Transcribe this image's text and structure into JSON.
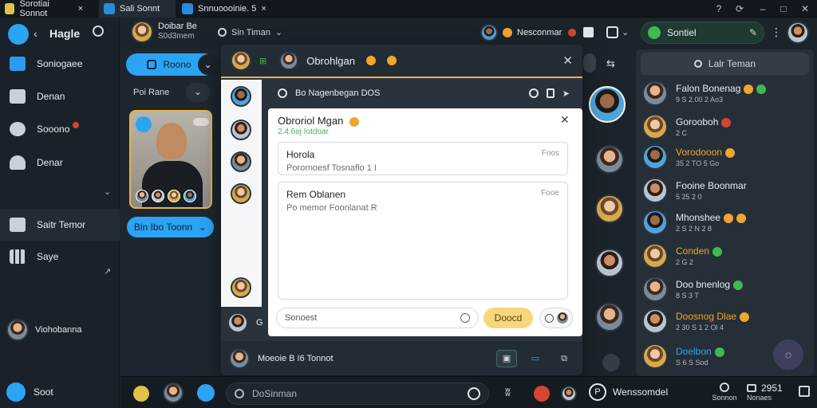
{
  "titlebar": {
    "tabs": [
      {
        "label": "Sorotiai Sonnot",
        "active": false
      },
      {
        "label": "Sali Sonnt",
        "active": true
      },
      {
        "label": "Snnuoooinie. 5",
        "active": false
      }
    ],
    "close_glyph": "×"
  },
  "sidebar": {
    "title": "Hagle",
    "items": [
      {
        "label": "Soniogaee",
        "icon": "chat-bubble-icon"
      },
      {
        "label": "Denan",
        "icon": "grid-icon"
      },
      {
        "label": "Sooono",
        "icon": "mic-icon"
      },
      {
        "label": "Denar",
        "icon": "cloud-icon"
      },
      {
        "label": "Saitr Temor",
        "icon": "folder-icon",
        "selected": true
      },
      {
        "label": "Saye",
        "icon": "apps-icon"
      }
    ],
    "profile_label": "Viohobanna",
    "footer_label": "Soot"
  },
  "header": {
    "channel_title": "Doibar Be",
    "channel_subtitle": "S0d3mem",
    "selector_label": "Sin Timan",
    "user_badge_label": "Nesconmar",
    "search_label": "Sontiel"
  },
  "col2": {
    "top_button": "Roono",
    "filter_label": "Poi Rane",
    "bottom_button": "Bin Ibo Toonn"
  },
  "dialog": {
    "title": "Obrohlgan",
    "thread_title": "Bo Nagenbegan DOS",
    "inner_title": "Obroriol Mgan",
    "inner_meta": "2.4.6oj Iotdoar",
    "messages": [
      {
        "title": "Horola",
        "sub": "Porornoesf Tosnaflo 1 I",
        "side": "Foos"
      },
      {
        "title": "Rem Oblanen",
        "sub": "Po memor Foonlanat R",
        "side": "Fooe"
      }
    ],
    "reply_placeholder": "Sonoest",
    "send_label": "Doocd",
    "row1_label": "G",
    "footer_label": "Moeoie B I6 Tonnot"
  },
  "right_panel": {
    "title": "Lalr Teman",
    "contacts": [
      {
        "name": "Falon Bonenag",
        "meta": "9 S 2.00 2 Ao3"
      },
      {
        "name": "Gorooboh",
        "meta": "2 C"
      },
      {
        "name": "Vorodooon",
        "meta": "35 2 TO 5 Go"
      },
      {
        "name": "Fooine Boonmar",
        "meta": "5 25 2 0"
      },
      {
        "name": "Mhonshee",
        "meta": "2 S 2 N 2 8"
      },
      {
        "name": "Conden",
        "meta": "2 G 2"
      },
      {
        "name": "Doo bnenlog",
        "meta": "8 S 3 T"
      },
      {
        "name": "Doosnog Dlae",
        "meta": "2 30 S 1 2 Ol 4"
      },
      {
        "name": "Doelbon",
        "meta": "S 6 S Sod"
      }
    ]
  },
  "bottombar": {
    "search_label": "DoSinman",
    "user_label": "Wenssomdel",
    "stat1_value": "",
    "stat1_label": "Sonnon",
    "stat2_value": "2951",
    "stat2_label": "Nonaes"
  }
}
